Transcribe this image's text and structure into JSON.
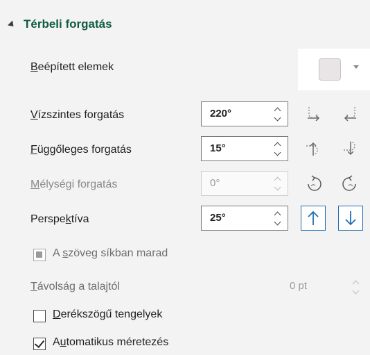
{
  "section": {
    "title": "Térbeli forgatás"
  },
  "presets": {
    "label_pre": "",
    "label_key": "B",
    "label_post": "eépített elemek"
  },
  "rotation": {
    "x": {
      "label_pre": "",
      "label_key": "V",
      "label_post": "ízszintes forgatás",
      "value": "220°"
    },
    "y": {
      "label_pre": "",
      "label_key": "F",
      "label_post": "üggőleges forgatás",
      "value": "15°"
    },
    "z": {
      "label_pre": "",
      "label_key": "M",
      "label_post": "élységi forgatás",
      "value": "0°"
    },
    "perspective": {
      "label_pre": "Perspe",
      "label_key": "k",
      "label_post": "tíva",
      "value": "25°"
    }
  },
  "keep_text_flat": {
    "label_pre": "A ",
    "label_key": "s",
    "label_post": "zöveg síkban marad",
    "checked": true,
    "disabled": true
  },
  "distance": {
    "label_pre": "",
    "label_key": "T",
    "label_post": "ávolság a talajtól",
    "value": "0 pt"
  },
  "right_angle_axes": {
    "label_pre": "",
    "label_key": "D",
    "label_post": "erékszögű tengelyek",
    "checked": false
  },
  "autoscale": {
    "label_pre": "A",
    "label_key": "u",
    "label_post": "tomatikus méretezés",
    "checked": true
  },
  "colors": {
    "accent": "#1f6fb5",
    "title": "#0f5c3f",
    "panel": "#f3f3f3"
  },
  "icons": [
    "rotate-left-icon",
    "rotate-right-icon",
    "rotate-up-icon",
    "rotate-down-icon",
    "rotate-ccw-icon",
    "rotate-cw-icon",
    "perspective-narrow-icon",
    "perspective-widen-icon"
  ]
}
